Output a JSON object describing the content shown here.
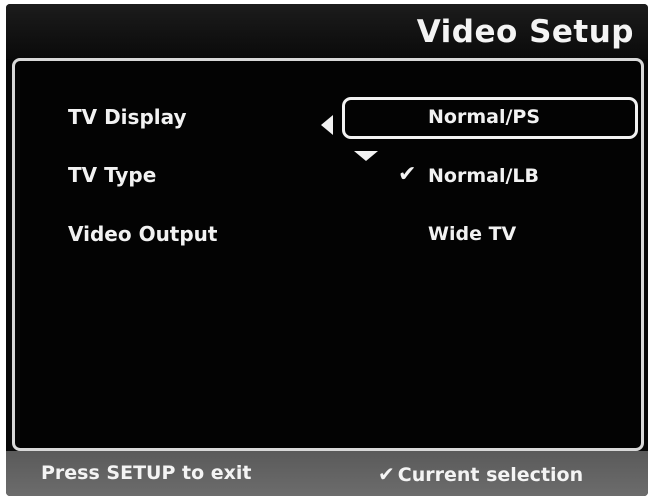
{
  "header": {
    "title": "Video Setup"
  },
  "menu": {
    "items": [
      {
        "label": "TV Display"
      },
      {
        "label": "TV Type"
      },
      {
        "label": "Video Output"
      }
    ]
  },
  "options": {
    "items": [
      {
        "label": "Normal/PS",
        "highlighted": true,
        "checked": false
      },
      {
        "label": "Normal/LB",
        "highlighted": false,
        "checked": true
      },
      {
        "label": "Wide TV",
        "highlighted": false,
        "checked": false
      }
    ]
  },
  "icons": {
    "left_arrow": "triangle-left-icon",
    "down_arrow": "triangle-down-icon",
    "check": "checkmark-icon"
  },
  "footer": {
    "exit_hint": "Press SETUP to exit",
    "legend_label": "Current selection"
  },
  "colors": {
    "background": "#070707",
    "text": "#f2f2f2",
    "footer_bar": "#636363"
  }
}
